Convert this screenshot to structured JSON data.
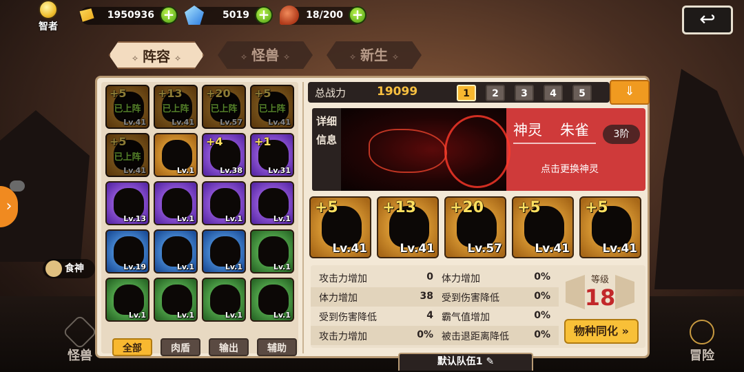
{
  "top_bar": {
    "sage_label": "智者",
    "gold": "1950936",
    "gems": "5019",
    "stamina": "18/200"
  },
  "tabs": [
    {
      "label": "阵容",
      "active": true
    },
    {
      "label": "怪兽",
      "active": false
    },
    {
      "label": "新生",
      "active": false
    }
  ],
  "roster": {
    "cards": [
      {
        "plus": "+5",
        "tag": "已上阵",
        "level": "Lv.41",
        "rarity": "gold",
        "dim": true
      },
      {
        "plus": "+13",
        "tag": "已上阵",
        "level": "Lv.41",
        "rarity": "gold",
        "dim": true
      },
      {
        "plus": "+20",
        "tag": "已上阵",
        "level": "Lv.57",
        "rarity": "gold",
        "dim": true
      },
      {
        "plus": "+5",
        "tag": "已上阵",
        "level": "Lv.41",
        "rarity": "gold",
        "dim": true
      },
      {
        "plus": "+5",
        "tag": "已上阵",
        "level": "Lv.41",
        "rarity": "gold",
        "dim": true
      },
      {
        "plus": "",
        "tag": "",
        "level": "Lv.1",
        "rarity": "gold",
        "dim": false
      },
      {
        "plus": "+4",
        "tag": "",
        "level": "Lv.38",
        "rarity": "purple",
        "dim": false
      },
      {
        "plus": "+1",
        "tag": "",
        "level": "Lv.31",
        "rarity": "purple",
        "dim": false
      },
      {
        "plus": "",
        "tag": "",
        "level": "Lv.13",
        "rarity": "purple",
        "dim": false
      },
      {
        "plus": "",
        "tag": "",
        "level": "Lv.1",
        "rarity": "purple",
        "dim": false
      },
      {
        "plus": "",
        "tag": "",
        "level": "Lv.1",
        "rarity": "purple",
        "dim": false
      },
      {
        "plus": "",
        "tag": "",
        "level": "Lv.1",
        "rarity": "purple",
        "dim": false
      },
      {
        "plus": "",
        "tag": "",
        "level": "Lv.19",
        "rarity": "blue",
        "dim": false
      },
      {
        "plus": "",
        "tag": "",
        "level": "Lv.1",
        "rarity": "blue",
        "dim": false
      },
      {
        "plus": "",
        "tag": "",
        "level": "Lv.1",
        "rarity": "blue",
        "dim": false
      },
      {
        "plus": "",
        "tag": "",
        "level": "Lv.1",
        "rarity": "green",
        "dim": false
      },
      {
        "plus": "",
        "tag": "",
        "level": "Lv.1",
        "rarity": "green",
        "dim": false
      },
      {
        "plus": "",
        "tag": "",
        "level": "Lv.1",
        "rarity": "green",
        "dim": false
      },
      {
        "plus": "",
        "tag": "",
        "level": "Lv.1",
        "rarity": "green",
        "dim": false
      },
      {
        "plus": "",
        "tag": "",
        "level": "Lv.1",
        "rarity": "green",
        "dim": false
      }
    ],
    "filters": [
      {
        "label": "全部",
        "active": true
      },
      {
        "label": "肉盾",
        "active": false
      },
      {
        "label": "输出",
        "active": false
      },
      {
        "label": "辅助",
        "active": false
      }
    ]
  },
  "team": {
    "power_label": "总战力",
    "power_value": "19099",
    "slots": [
      {
        "label": "1",
        "active": true
      },
      {
        "label": "2",
        "active": false
      },
      {
        "label": "3",
        "active": false
      },
      {
        "label": "4",
        "active": false
      },
      {
        "label": "5",
        "active": false
      }
    ],
    "detail_tab": "详细信息",
    "guardian": {
      "type": "神灵",
      "name": "朱雀",
      "rank": "3阶",
      "hint": "点击更换神灵"
    },
    "members": [
      {
        "plus": "+5",
        "level": "Lv.41"
      },
      {
        "plus": "+13",
        "level": "Lv.41"
      },
      {
        "plus": "+20",
        "level": "Lv.57"
      },
      {
        "plus": "+5",
        "level": "Lv.41"
      },
      {
        "plus": "+5",
        "level": "Lv.41"
      }
    ],
    "stats": [
      {
        "k1": "攻击力增加",
        "v1": "0",
        "k2": "体力增加",
        "v2": "0%"
      },
      {
        "k1": "体力增加",
        "v1": "38",
        "k2": "受到伤害降低",
        "v2": "0%"
      },
      {
        "k1": "受到伤害降低",
        "v1": "4",
        "k2": "霸气值增加",
        "v2": "0%"
      },
      {
        "k1": "攻击力增加",
        "v1": "0%",
        "k2": "被击退距离降低",
        "v2": "0%"
      }
    ],
    "level_label": "等级",
    "level_value": "18",
    "sync_button": "物种同化",
    "team_name": "默认队伍1"
  },
  "side": {
    "food_god": "食神"
  },
  "bottom_nav": [
    {
      "label": "怪兽"
    },
    {
      "label": "冒险"
    }
  ],
  "colors": {
    "accent_orange": "#f8b830",
    "power_gold": "#f8c040",
    "level_red": "#c2282a",
    "guardian_red": "#cf3a3a"
  }
}
